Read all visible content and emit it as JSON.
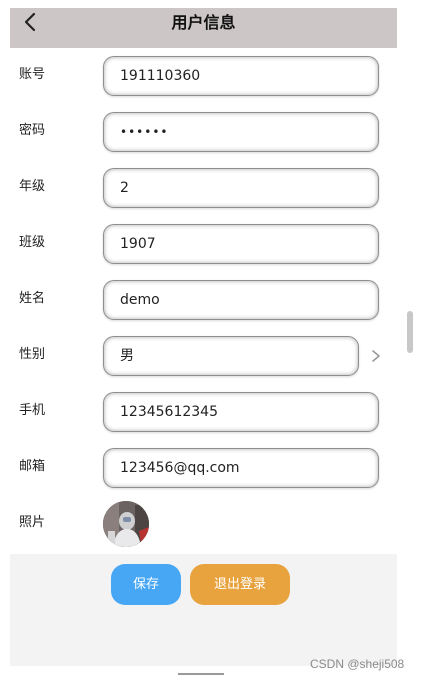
{
  "header": {
    "title": "用户信息",
    "back_icon": "chevron-left-icon"
  },
  "form": {
    "fields": [
      {
        "label": "账号",
        "value": "191110360"
      },
      {
        "label": "密码",
        "value": "••••••"
      },
      {
        "label": "年级",
        "value": "2"
      },
      {
        "label": "班级",
        "value": "1907"
      },
      {
        "label": "姓名",
        "value": "demo"
      },
      {
        "label": "性别",
        "value": "男"
      },
      {
        "label": "手机",
        "value": "12345612345"
      },
      {
        "label": "邮箱",
        "value": "123456@qq.com"
      }
    ],
    "photo_label": "照片",
    "gender_chevron_icon": "chevron-right-icon"
  },
  "actions": {
    "save_label": "保存",
    "logout_label": "退出登录"
  },
  "watermark": "CSDN @sheji508",
  "colors": {
    "header_bg": "#cdc6c6",
    "save_button": "#47a7f5",
    "logout_button": "#e8a33e"
  }
}
